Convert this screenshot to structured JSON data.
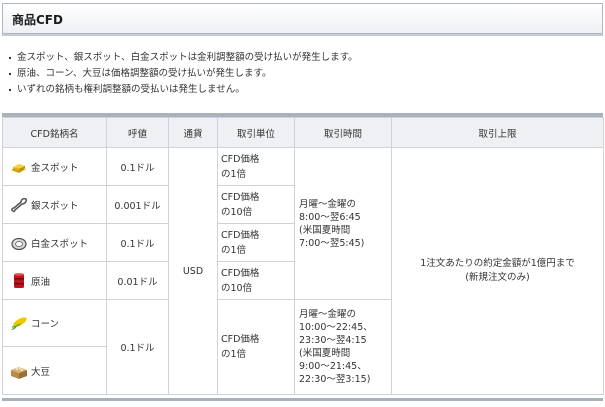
{
  "header": {
    "title": "商品CFD"
  },
  "notes": [
    "金スポット、銀スポット、白金スポットは金利調整額の受け払いが発生します。",
    "原油、コーン、大豆は価格調整額の受け払いが発生します。",
    "いずれの銘柄も権利調整額の受払いは発生しません。"
  ],
  "table": {
    "headers": [
      "CFD銘柄名",
      "呼値",
      "通貨",
      "取引単位",
      "取引時間",
      "取引上限"
    ],
    "rows": [
      {
        "name": "金スポット",
        "icon": "gold-bar-icon",
        "tick": "0.1ドル",
        "unit": [
          "CFD価格",
          "の1倍"
        ]
      },
      {
        "name": "銀スポット",
        "icon": "silver-spoon-icon",
        "tick": "0.001ドル",
        "unit": [
          "CFD価格",
          "の10倍"
        ]
      },
      {
        "name": "白金スポット",
        "icon": "platinum-ring-icon",
        "tick": "0.1ドル",
        "unit": [
          "CFD価格",
          "の1倍"
        ]
      },
      {
        "name": "原油",
        "icon": "oil-drum-icon",
        "tick": "0.01ドル",
        "unit": [
          "CFD価格",
          "の10倍"
        ]
      },
      {
        "name": "コーン",
        "icon": "corn-icon"
      },
      {
        "name": "大豆",
        "icon": "soybean-box-icon"
      }
    ],
    "grain_tick": "0.1ドル",
    "grain_unit": [
      "CFD価格",
      "の1倍"
    ],
    "currency": "USD",
    "time_metals": [
      "月曜～金曜の",
      "8:00～翌6:45",
      "(米国夏時間",
      "7:00～翌5:45)"
    ],
    "time_grains": [
      "月曜～金曜の",
      "10:00～22:45、",
      "23:30～翌4:15",
      "(米国夏時間",
      "9:00～21:45、",
      "22:30～翌3:15)"
    ],
    "limit": [
      "1注文あたりの約定金額が1億円まで",
      "(新規注文のみ)"
    ]
  }
}
